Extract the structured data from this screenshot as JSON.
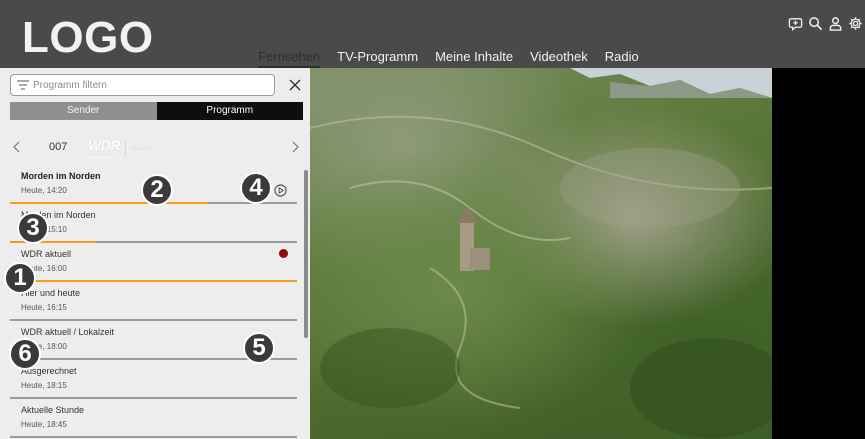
{
  "header": {
    "logo": "LOGO",
    "nav": [
      {
        "label": "Fernsehen",
        "active": true
      },
      {
        "label": "TV-Programm",
        "active": false
      },
      {
        "label": "Meine Inhalte",
        "active": false
      },
      {
        "label": "Videothek",
        "active": false
      },
      {
        "label": "Radio",
        "active": false
      }
    ],
    "icons": [
      "add-channel-icon",
      "search-icon",
      "user-icon",
      "settings-icon"
    ]
  },
  "sidebar": {
    "filter_placeholder": "Programm filtern",
    "toggle": {
      "sender_label": "Sender",
      "programm_label": "Programm",
      "selected": "Programm"
    },
    "channel": {
      "number": "007",
      "logo_text": "WDR",
      "logo_subtext": "FERNSEHEN",
      "hd_label": "HD KÖLN"
    },
    "programs": [
      {
        "title": "Morden im Norden",
        "time": "Heute, 14:20",
        "progress": 0.69
      },
      {
        "title": "Morden im Norden",
        "time": "Heute, 15:10",
        "progress": 0.3
      },
      {
        "title": "WDR aktuell",
        "time": "Heute, 16:00",
        "progress": 1.0
      },
      {
        "title": "Hier und heute",
        "time": "Heute, 16:15",
        "progress": 0.0
      },
      {
        "title": "WDR aktuell / Lokalzeit",
        "time": "Heute, 18:00",
        "progress": 0.0
      },
      {
        "title": "Ausgerechnet",
        "time": "Heute, 18:15",
        "progress": 0.0
      },
      {
        "title": "Aktuelle Stunde",
        "time": "Heute, 18:45",
        "progress": 0.0
      }
    ]
  },
  "markers": [
    "1",
    "2",
    "3",
    "4",
    "5",
    "6"
  ],
  "colors": {
    "header_bg": "#4a4a4a",
    "accent_progress": "#f59b23",
    "record_dot": "#8a0c0c",
    "panel_bg": "#ededed"
  }
}
